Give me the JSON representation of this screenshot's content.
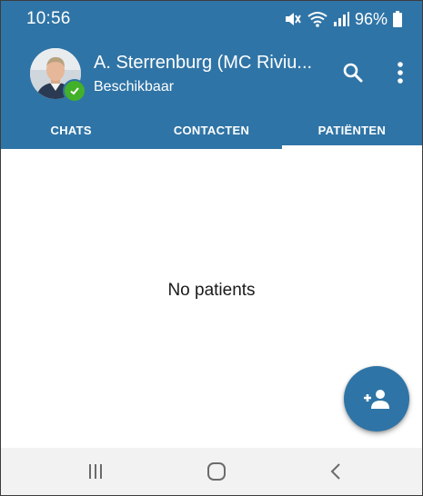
{
  "status_bar": {
    "time": "10:56",
    "battery": "96%",
    "icons": [
      "mute-icon",
      "wifi-icon",
      "signal-icon",
      "battery-icon"
    ]
  },
  "header": {
    "contact_name": "A. Sterrenburg (MC Riviu...",
    "contact_status": "Beschikbaar",
    "actions": [
      "search-icon",
      "more-vert-icon"
    ]
  },
  "tabs": [
    {
      "label": "CHATS",
      "active": false
    },
    {
      "label": "CONTACTEN",
      "active": false
    },
    {
      "label": "PATIËNTEN",
      "active": true
    }
  ],
  "main": {
    "empty_message": "No patients"
  },
  "fab": {
    "icon": "add-person-icon"
  },
  "nav_bar": {
    "icons": [
      "recents-icon",
      "home-icon",
      "back-icon"
    ]
  },
  "colors": {
    "primary": "#2f74a6",
    "online_badge": "#43b02a",
    "nav_background": "#f2f2f2"
  }
}
